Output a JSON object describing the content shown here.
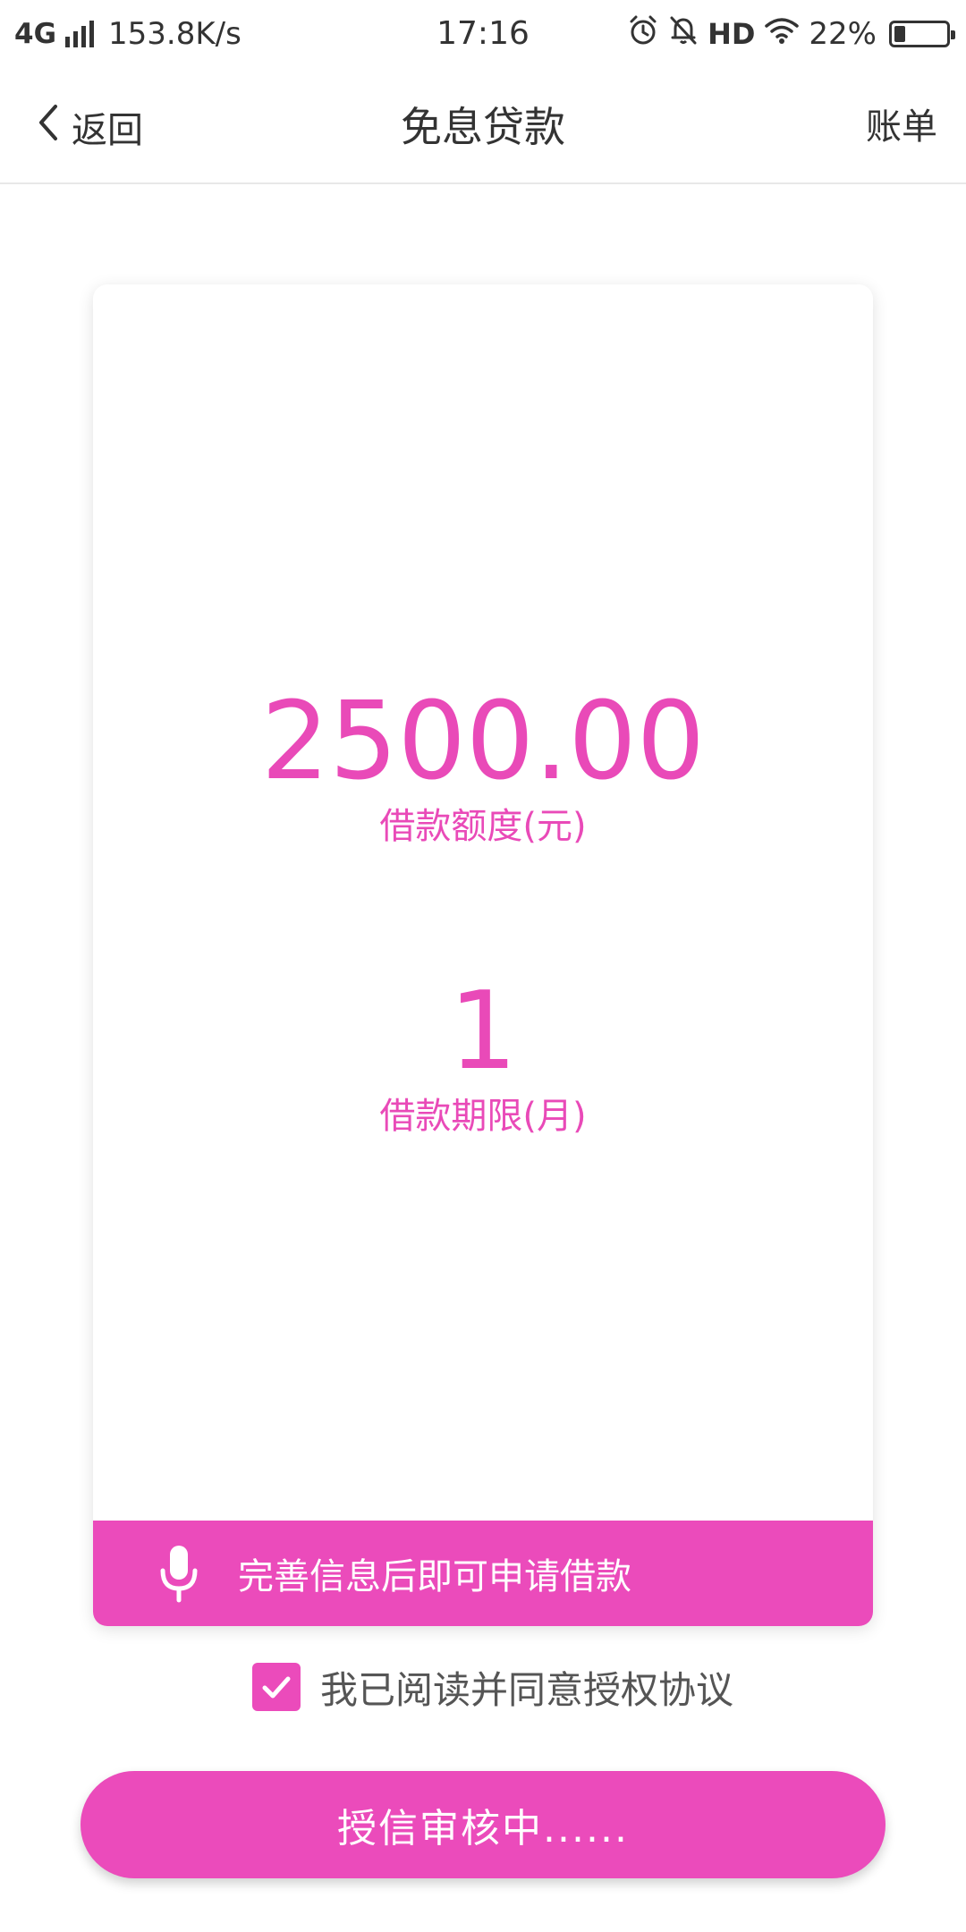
{
  "status_bar": {
    "network": "4G",
    "speed": "153.8K/s",
    "time": "17:16",
    "hd": "HD",
    "battery": "22%",
    "battery_level": 0.22
  },
  "nav": {
    "back_label": "返回",
    "title": "免息贷款",
    "right_label": "账单"
  },
  "loan": {
    "amount": "2500.00",
    "amount_label": "借款额度(元)",
    "term": "1",
    "term_label": "借款期限(月)"
  },
  "notice": {
    "text": "完善信息后即可申请借款"
  },
  "agreement": {
    "text": "我已阅读并同意授权协议",
    "checked": true
  },
  "submit": {
    "label": "授信审核中......"
  },
  "colors": {
    "accent": "#eb4bbb",
    "accent_text": "#e94ab8",
    "text_dark": "#333333"
  },
  "icons": [
    "back-chevron-icon",
    "alarm-icon",
    "mute-bell-icon",
    "wifi-icon",
    "battery-icon",
    "signal-icon",
    "microphone-icon",
    "check-icon"
  ]
}
